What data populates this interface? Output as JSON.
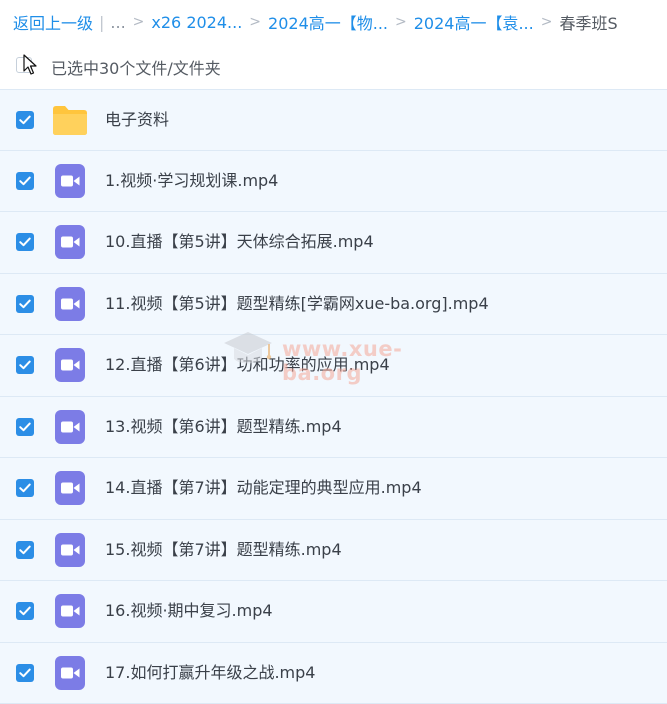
{
  "breadcrumb": {
    "back_label": "返回上一级",
    "ellipsis": "...",
    "crumbs": [
      "x26 2024...",
      "2024高一【物...",
      "2024高一【袁..."
    ],
    "current": "春季班S"
  },
  "selection": {
    "label": "已选中30个文件/文件夹"
  },
  "files": [
    {
      "name": "电子资料",
      "type": "folder-icon"
    },
    {
      "name": "1.视频·学习规划课.mp4",
      "type": "video-file-icon"
    },
    {
      "name": "10.直播【第5讲】天体综合拓展.mp4",
      "type": "video-file-icon"
    },
    {
      "name": "11.视频【第5讲】题型精练[学霸网xue-ba.org].mp4",
      "type": "video-file-icon"
    },
    {
      "name": "12.直播【第6讲】功和功率的应用.mp4",
      "type": "video-file-icon"
    },
    {
      "name": "13.视频【第6讲】题型精练.mp4",
      "type": "video-file-icon"
    },
    {
      "name": "14.直播【第7讲】动能定理的典型应用.mp4",
      "type": "video-file-icon"
    },
    {
      "name": "15.视频【第7讲】题型精练.mp4",
      "type": "video-file-icon"
    },
    {
      "name": "16.视频·期中复习.mp4",
      "type": "video-file-icon"
    },
    {
      "name": "17.如何打赢升年级之战.mp4",
      "type": "video-file-icon"
    }
  ],
  "watermark": {
    "text": "www.xue-ba.org"
  },
  "colors": {
    "link": "#1f8ee8",
    "checkbox": "#2c8ee6",
    "video_icon": "#7c7ce6",
    "folder": "#ffc53d",
    "row_bg": "#f2f8fe"
  }
}
